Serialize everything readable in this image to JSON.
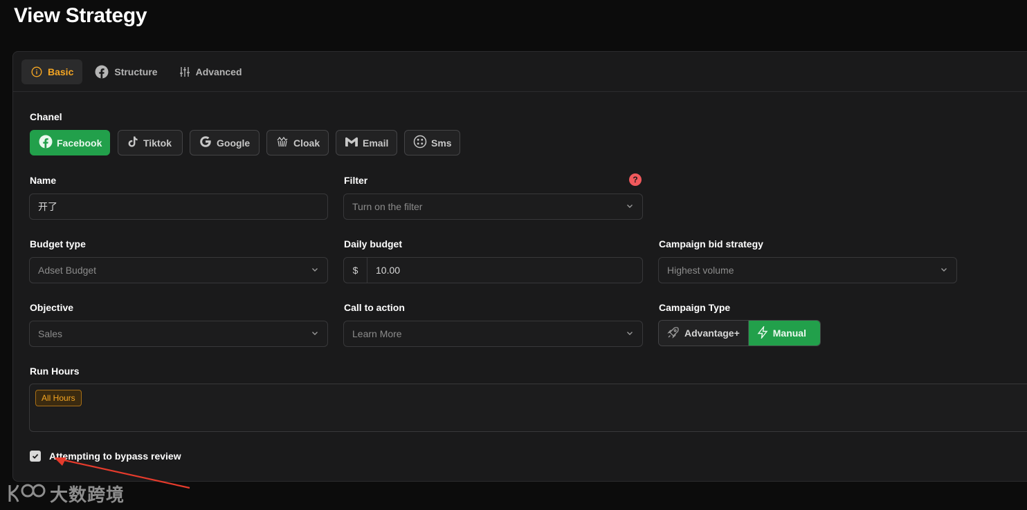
{
  "page": {
    "title": "View Strategy"
  },
  "tabs": [
    {
      "label": "Basic",
      "icon": "info-icon",
      "active": true
    },
    {
      "label": "Structure",
      "icon": "facebook-icon",
      "active": false
    },
    {
      "label": "Advanced",
      "icon": "sliders-icon",
      "active": false
    }
  ],
  "channel": {
    "label": "Chanel",
    "options": [
      {
        "label": "Facebook",
        "icon": "facebook-icon",
        "active": true
      },
      {
        "label": "Tiktok",
        "icon": "tiktok-icon",
        "active": false
      },
      {
        "label": "Google",
        "icon": "google-icon",
        "active": false
      },
      {
        "label": "Cloak",
        "icon": "cloak-icon",
        "active": false
      },
      {
        "label": "Email",
        "icon": "gmail-icon",
        "active": false
      },
      {
        "label": "Sms",
        "icon": "sms-icon",
        "active": false
      }
    ]
  },
  "name": {
    "label": "Name",
    "value": "开了"
  },
  "filter": {
    "label": "Filter",
    "placeholder": "Turn on the filter",
    "help": "?"
  },
  "budget_type": {
    "label": "Budget type",
    "value": "Adset Budget"
  },
  "daily_budget": {
    "label": "Daily budget",
    "currency": "$",
    "value": "10.00"
  },
  "bid_strategy": {
    "label": "Campaign bid strategy",
    "value": "Highest volume"
  },
  "objective": {
    "label": "Objective",
    "value": "Sales"
  },
  "call_to_action": {
    "label": "Call to action",
    "value": "Learn More"
  },
  "campaign_type": {
    "label": "Campaign Type",
    "options": [
      {
        "label": "Advantage+",
        "icon": "rocket-icon",
        "active": false
      },
      {
        "label": "Manual",
        "icon": "bolt-icon",
        "active": true
      }
    ]
  },
  "run_hours": {
    "label": "Run Hours",
    "tags": [
      "All Hours"
    ]
  },
  "bypass_review": {
    "label": "Attempting to bypass review",
    "checked": true
  },
  "watermark": {
    "text": "大数跨境"
  },
  "colors": {
    "accent": "#f5a623",
    "success": "#22a04b",
    "danger": "#f0595c",
    "background": "#0c0c0c",
    "panel": "#1a1a1b"
  }
}
